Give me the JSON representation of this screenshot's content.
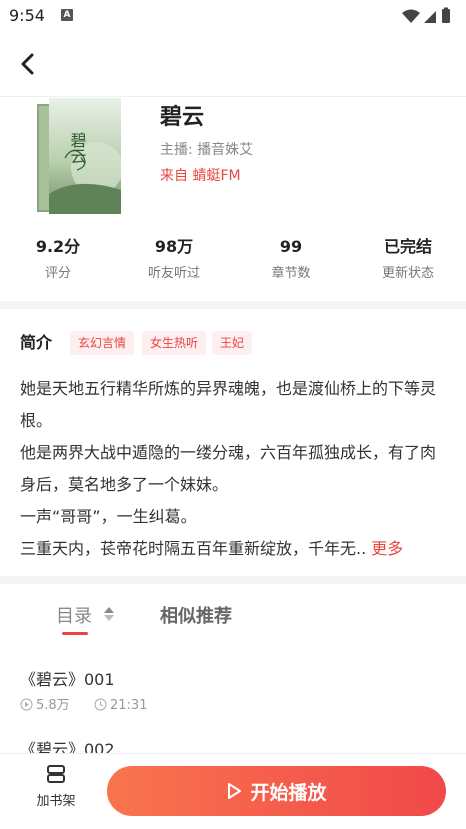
{
  "status_bar": {
    "time": "9:54",
    "notification_icon_letter": "A"
  },
  "book": {
    "title": "碧云",
    "cover_title_glyphs": "碧云",
    "host": "主播: 播音姝艾",
    "source": "来自 蜻蜓FM"
  },
  "stats": [
    {
      "value": "9.2分",
      "label": "评分"
    },
    {
      "value": "98万",
      "label": "听友听过"
    },
    {
      "value": "99",
      "label": "章节数"
    },
    {
      "value": "已完结",
      "label": "更新状态"
    }
  ],
  "intro": {
    "heading": "简介",
    "tags": [
      "玄幻言情",
      "女生热听",
      "王妃"
    ],
    "lines": [
      "她是天地五行精华所炼的异界魂魄，也是渡仙桥上的下等灵根。",
      "他是两界大战中遁隐的一缕分魂，六百年孤独成长，有了肉身后，莫名地多了一个妹妹。",
      "一声“哥哥”，一生纠葛。"
    ],
    "last_line": "三重天内，苌帝花时隔五百年重新绽放，千年无..",
    "more_label": "更多"
  },
  "tabs": {
    "catalog": "目录",
    "similar": "相似推荐"
  },
  "chapters": [
    {
      "title": "《碧云》001",
      "plays": "5.8万",
      "duration": "21:31"
    },
    {
      "title": "《碧云》002",
      "plays": "",
      "duration": ""
    }
  ],
  "bottom_bar": {
    "shelf_label": "加书架",
    "play_label": "开始播放"
  },
  "colors": {
    "accent": "#e8463f",
    "tag_bg": "#fdeef0",
    "gradient_start": "#f9744e",
    "gradient_end": "#f1484a"
  }
}
